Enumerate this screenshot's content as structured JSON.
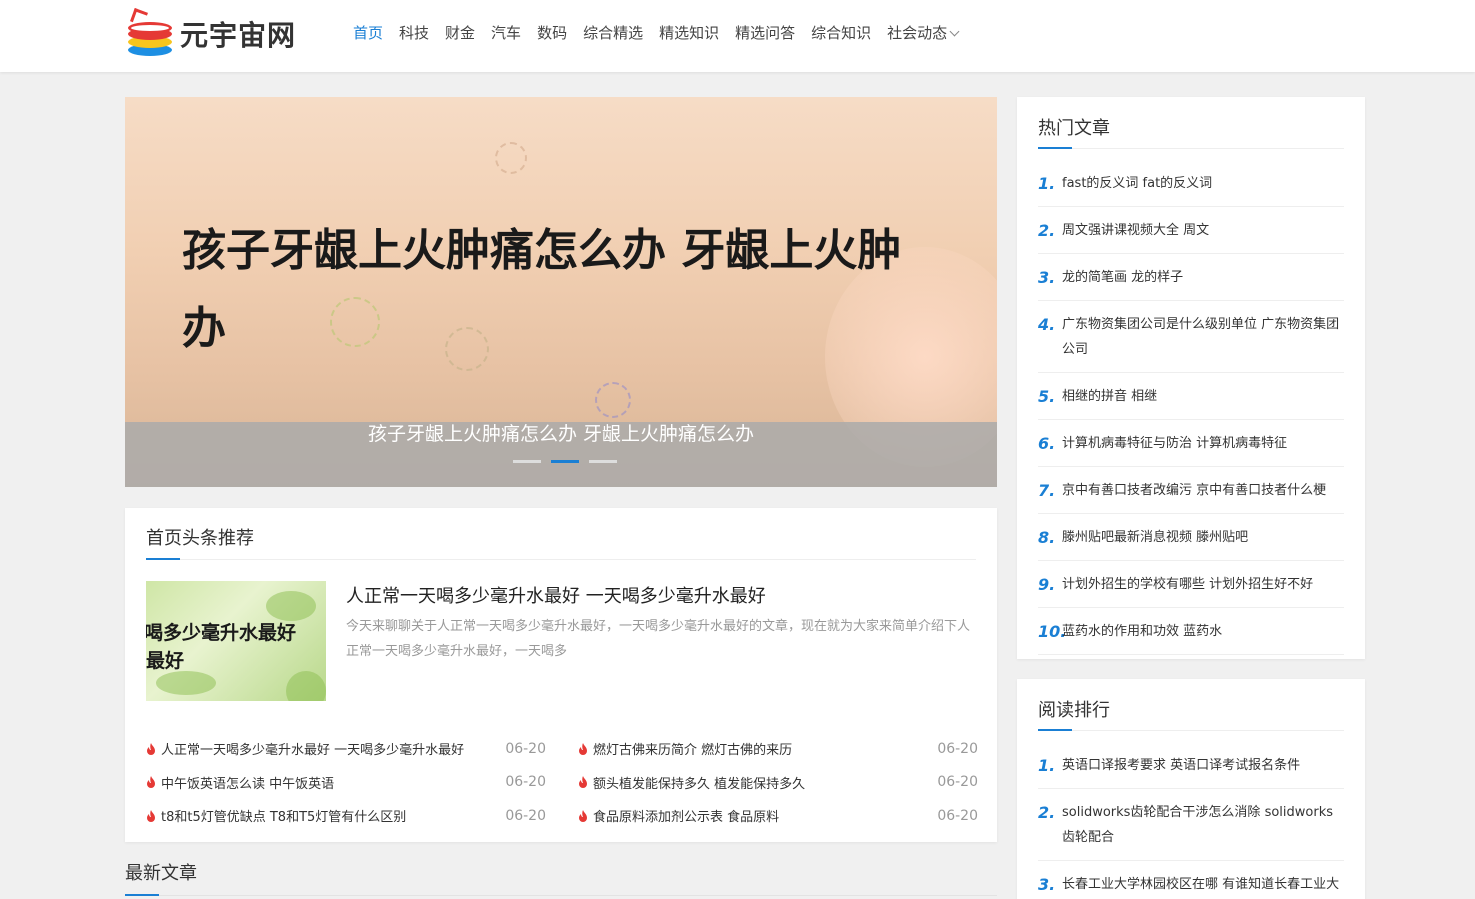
{
  "brand": {
    "name": "元宇宙网",
    "logo_icon": "pot-stack-logo"
  },
  "nav": {
    "items": [
      "首页",
      "科技",
      "财金",
      "汽车",
      "数码",
      "综合精选",
      "精选知识",
      "精选问答",
      "综合知识",
      "社会动态"
    ],
    "active_index": 0
  },
  "slider": {
    "image_text_line1": "孩子牙龈上火肿痛怎么办 牙龈上火肿",
    "image_text_line2": "办",
    "caption": "孩子牙龈上火肿痛怎么办 牙龈上火肿痛怎么办",
    "dots": 3,
    "active_dot": 1
  },
  "headline": {
    "title": "首页头条推荐",
    "featured": {
      "thumb_line1": "一天喝多少毫升水最好",
      "thumb_line2": "最好",
      "title": "人正常一天喝多少毫升水最好 一天喝多少毫升水最好",
      "desc": "今天来聊聊关于人正常一天喝多少毫升水最好，一天喝多少毫升水最好的文章，现在就为大家来简单介绍下人正常一天喝多少毫升水最好，一天喝多"
    },
    "news_left": [
      {
        "title": "人正常一天喝多少毫升水最好 一天喝多少毫升水最好",
        "date": "06-20"
      },
      {
        "title": "中午饭英语怎么读 中午饭英语",
        "date": "06-20"
      },
      {
        "title": "t8和t5灯管优缺点 T8和T5灯管有什么区别",
        "date": "06-20"
      }
    ],
    "news_right": [
      {
        "title": "燃灯古佛来历简介 燃灯古佛的来历",
        "date": "06-20"
      },
      {
        "title": "额头植发能保持多久 植发能保持多久",
        "date": "06-20"
      },
      {
        "title": "食品原料添加剂公示表 食品原料",
        "date": "06-20"
      }
    ]
  },
  "latest": {
    "title": "最新文章"
  },
  "hot": {
    "title": "热门文章",
    "items": [
      {
        "num": "1.",
        "text": "fast的反义词 fat的反义词"
      },
      {
        "num": "2.",
        "text": "周文强讲课视频大全 周文"
      },
      {
        "num": "3.",
        "text": "龙的简笔画 龙的样子"
      },
      {
        "num": "4.",
        "text": "广东物资集团公司是什么级别单位 广东物资集团公司"
      },
      {
        "num": "5.",
        "text": "相继的拼音 相继"
      },
      {
        "num": "6.",
        "text": "计算机病毒特征与防治 计算机病毒特征"
      },
      {
        "num": "7.",
        "text": "京中有善口技者改编污 京中有善口技者什么梗"
      },
      {
        "num": "8.",
        "text": "滕州贴吧最新消息视频 滕州贴吧"
      },
      {
        "num": "9.",
        "text": "计划外招生的学校有哪些 计划外招生好不好"
      },
      {
        "num": "10.",
        "text": "蓝药水的作用和功效 蓝药水"
      }
    ]
  },
  "reading": {
    "title": "阅读排行",
    "items": [
      {
        "num": "1.",
        "text": "英语口译报考要求 英语口译考试报名条件"
      },
      {
        "num": "2.",
        "text": "solidworks齿轮配合干涉怎么消除 solidworks齿轮配合"
      },
      {
        "num": "3.",
        "text": "长春工业大学林园校区在哪 有谁知道长春工业大学林园校区在哪"
      }
    ]
  },
  "colors": {
    "accent": "#1a7fd4",
    "fire": "#e53935"
  }
}
